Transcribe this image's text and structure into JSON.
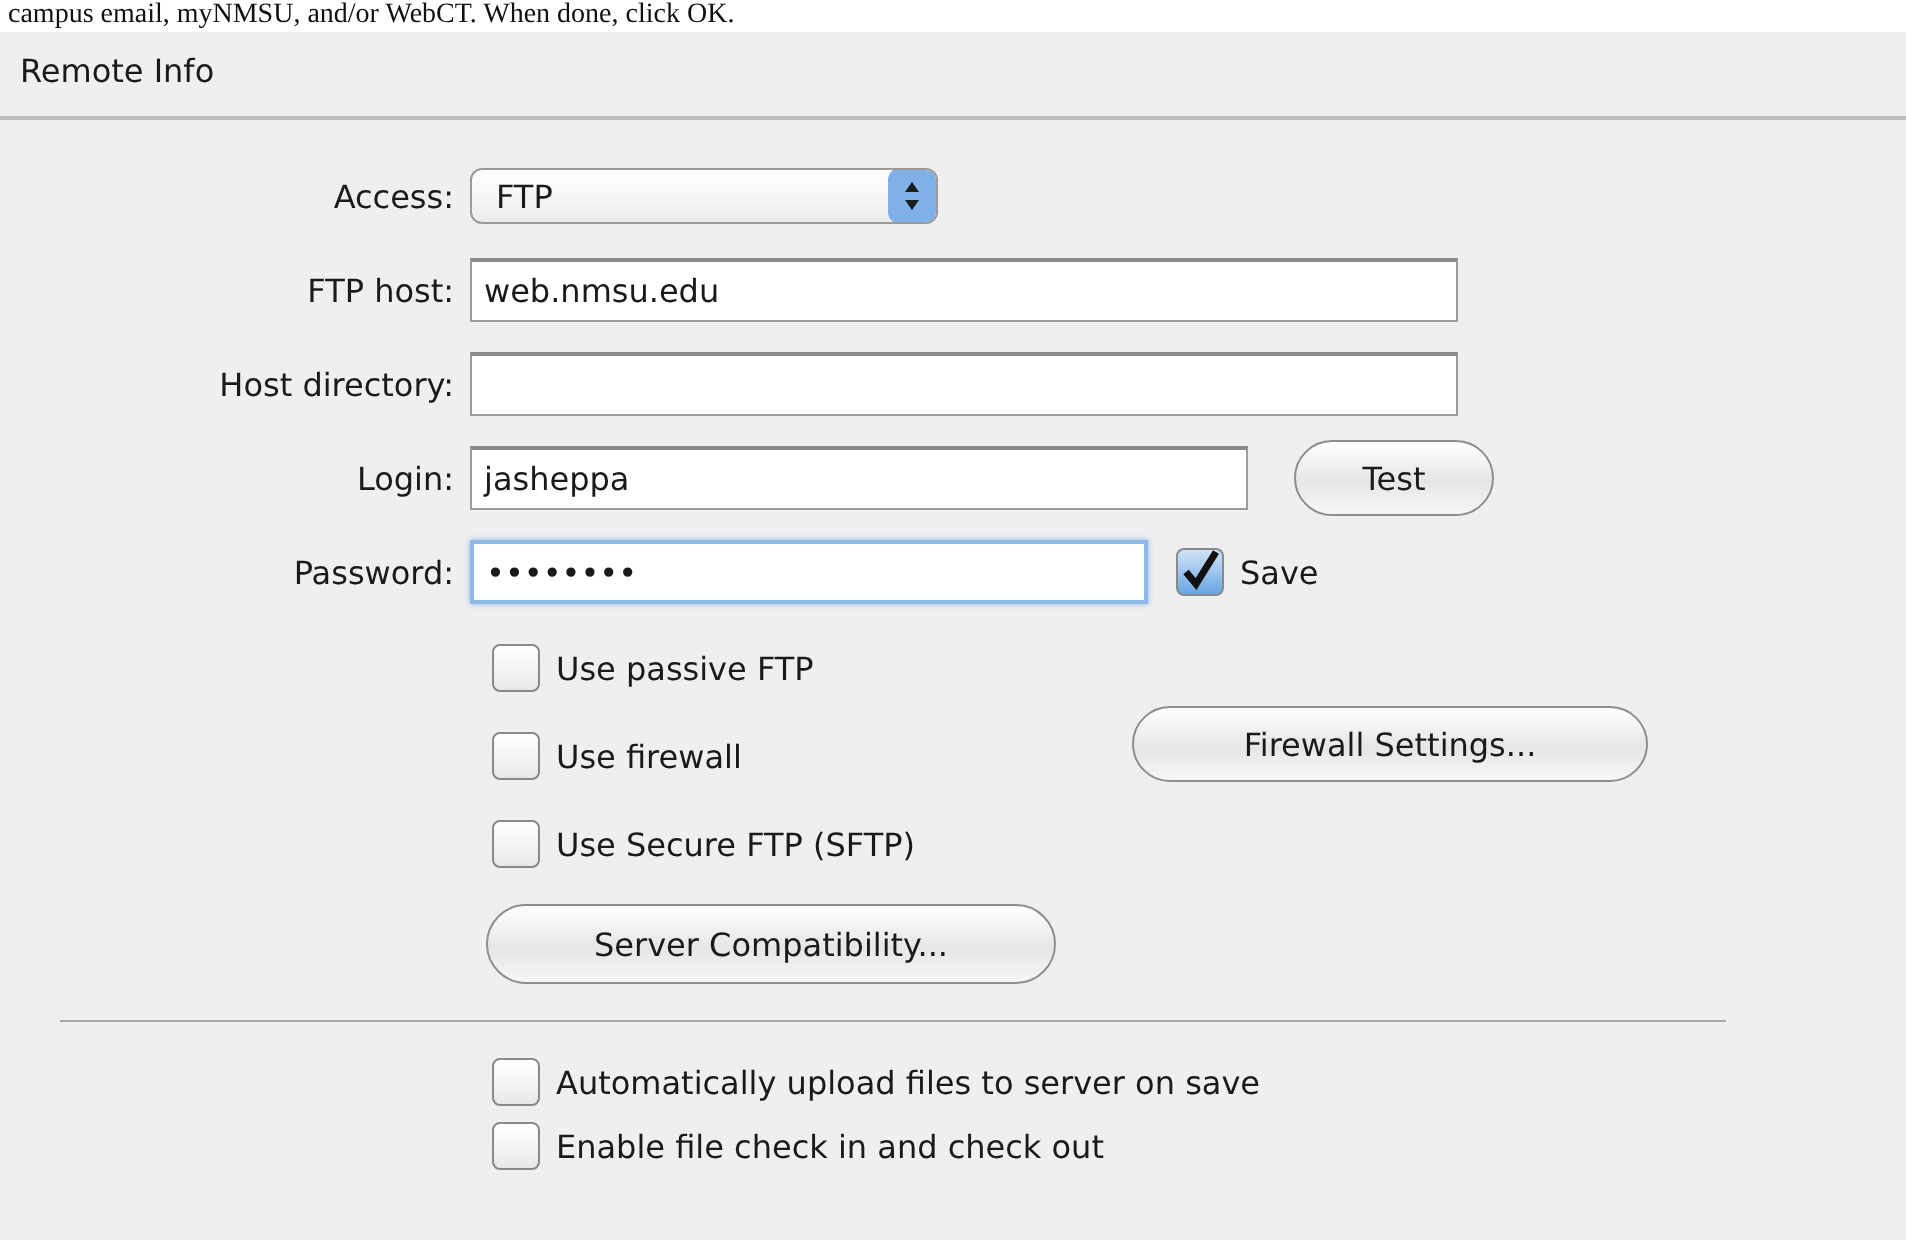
{
  "intro_text": "campus email, myNMSU, and/or WebCT. When done, click OK.",
  "panel": {
    "title": "Remote Info"
  },
  "form_rows": [
    {
      "kind": "select",
      "label": "Access:",
      "value": "FTP"
    },
    {
      "kind": "text",
      "label": "FTP host:",
      "value": "web.nmsu.edu",
      "focused": false
    },
    {
      "kind": "text",
      "label": "Host directory:",
      "value": "",
      "focused": false
    },
    {
      "kind": "login",
      "label": "Login:",
      "value": "jasheppa",
      "focused": false,
      "button": "Test"
    },
    {
      "kind": "password",
      "label": "Password:",
      "value": "••••••••",
      "focused": true,
      "checkbox": {
        "label": "Save",
        "checked": true
      }
    }
  ],
  "options": [
    {
      "label": "Use passive FTP",
      "checked": false
    },
    {
      "label": "Use firewall",
      "checked": false,
      "button": "Firewall Settings..."
    },
    {
      "label": "Use Secure FTP (SFTP)",
      "checked": false
    }
  ],
  "compatibility_button": "Server Compatibility...",
  "bottom_options": [
    {
      "label": "Automatically upload files to server on save",
      "checked": false
    },
    {
      "label": "Enable file check in and check out",
      "checked": false
    }
  ]
}
